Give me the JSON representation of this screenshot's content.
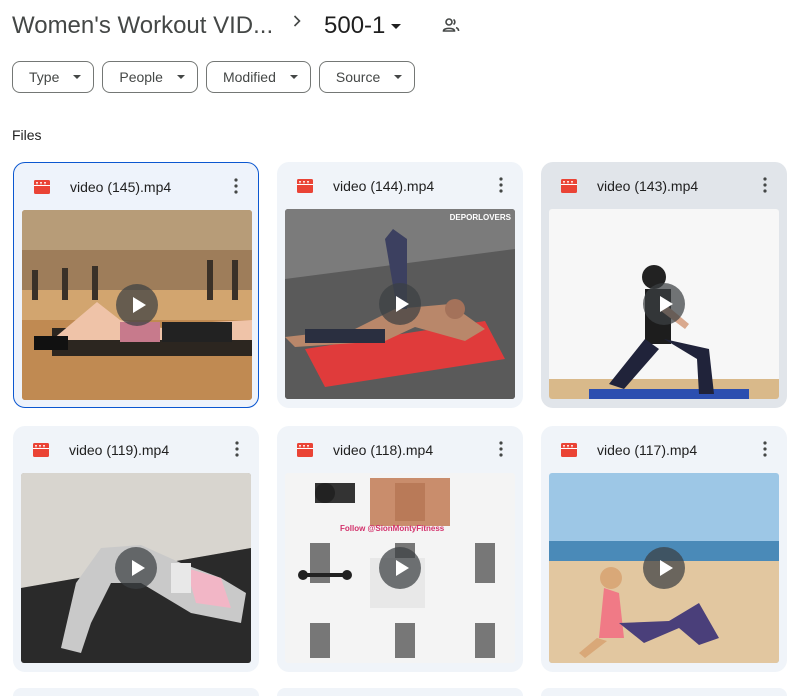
{
  "header": {
    "parent_folder": "Women's Workout VID...",
    "current_folder": "500-1",
    "separator_icon": "chevron-right-icon",
    "shared_icon": "people-icon"
  },
  "filters": [
    {
      "label": "Type"
    },
    {
      "label": "People"
    },
    {
      "label": "Modified"
    },
    {
      "label": "Source"
    }
  ],
  "section": {
    "label": "Files"
  },
  "files": [
    {
      "name": "video (145).mp4",
      "icon": "video-file-icon",
      "state": "selected"
    },
    {
      "name": "video (144).mp4",
      "icon": "video-file-icon",
      "state": "default",
      "watermark": "DEPORLOVERS"
    },
    {
      "name": "video (143).mp4",
      "icon": "video-file-icon",
      "state": "hovered"
    },
    {
      "name": "video (119).mp4",
      "icon": "video-file-icon",
      "state": "default"
    },
    {
      "name": "video (118).mp4",
      "icon": "video-file-icon",
      "state": "default",
      "overlay_text": "Follow @SionMontyFitness"
    },
    {
      "name": "video (117).mp4",
      "icon": "video-file-icon",
      "state": "default"
    }
  ],
  "colors": {
    "accent": "#0b57d0",
    "card_bg": "#f0f4f9",
    "video_icon": "#ea4335",
    "text": "#1f1f1f"
  }
}
